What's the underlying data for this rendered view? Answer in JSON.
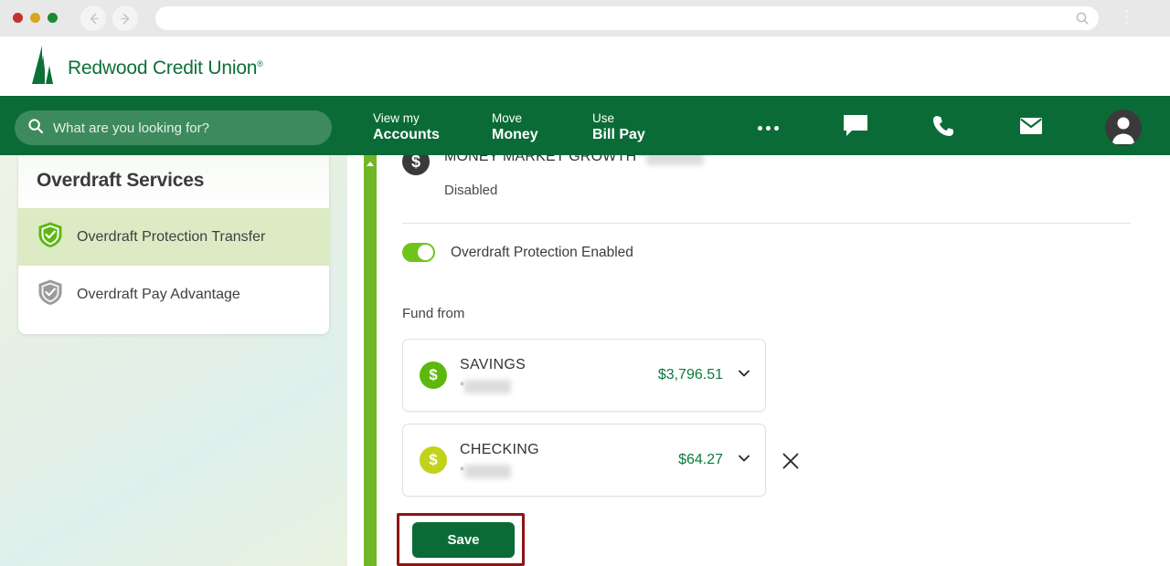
{
  "browser": {
    "traffic_lights": [
      "close",
      "minimize",
      "maximize"
    ],
    "back_label": "Back",
    "forward_label": "Forward",
    "url_value": "",
    "url_placeholder": "",
    "search_icon": "search-icon",
    "menu_icon": "kebab-menu-icon"
  },
  "header": {
    "brand_name": "Redwood Credit Union",
    "brand_tm": "®",
    "logo_icon": "redwood-tree-logo"
  },
  "nav": {
    "search_placeholder": "What are you looking for?",
    "search_icon": "search-icon",
    "links": [
      {
        "line1": "View my",
        "line2": "Accounts"
      },
      {
        "line1": "Move",
        "line2": "Money"
      },
      {
        "line1": "Use",
        "line2": "Bill Pay"
      }
    ],
    "icons": [
      {
        "name": "more-icon",
        "label": "More"
      },
      {
        "name": "chat-icon",
        "label": "Chat"
      },
      {
        "name": "phone-icon",
        "label": "Call"
      },
      {
        "name": "mail-icon",
        "label": "Messages"
      },
      {
        "name": "profile-icon",
        "label": "Profile"
      }
    ]
  },
  "sidebar": {
    "title": "Overdraft Services",
    "items": [
      {
        "label": "Overdraft Protection Transfer",
        "icon": "shield-check-icon",
        "active": true
      },
      {
        "label": "Overdraft Pay Advantage",
        "icon": "shield-check-icon",
        "active": false
      }
    ]
  },
  "main": {
    "clipped_account": {
      "name": "MONEY MARKET GROWTH",
      "mask_prefix": "*",
      "mask_value": "redacted",
      "status": "Disabled",
      "icon": "dollar-coin-icon"
    },
    "toggle": {
      "label": "Overdraft Protection Enabled",
      "state": "on"
    },
    "fund_from_label": "Fund from",
    "accounts": [
      {
        "name": "SAVINGS",
        "mask_prefix": "*",
        "mask_value": "redacted",
        "amount": "$3,796.51",
        "icon": "dollar-coin-icon",
        "color": "#5cb80e",
        "removable": false
      },
      {
        "name": "CHECKING",
        "mask_prefix": "*",
        "mask_value": "redacted",
        "amount": "$64.27",
        "icon": "dollar-coin-icon",
        "color": "#c2d21a",
        "removable": true
      }
    ],
    "remove_icon": "close-x-icon",
    "chevron_icon": "chevron-down-icon",
    "save_label": "Save"
  },
  "scrollbar": {
    "arrow_icon": "scroll-up-arrow-icon",
    "color": "#6fb724"
  },
  "colors": {
    "brand_green": "#0b6b36",
    "accent_green": "#6fc41b",
    "amount_green": "#0b7a3c",
    "annotation_red": "#8d1414",
    "sidebar_active": "#dcebc4"
  }
}
